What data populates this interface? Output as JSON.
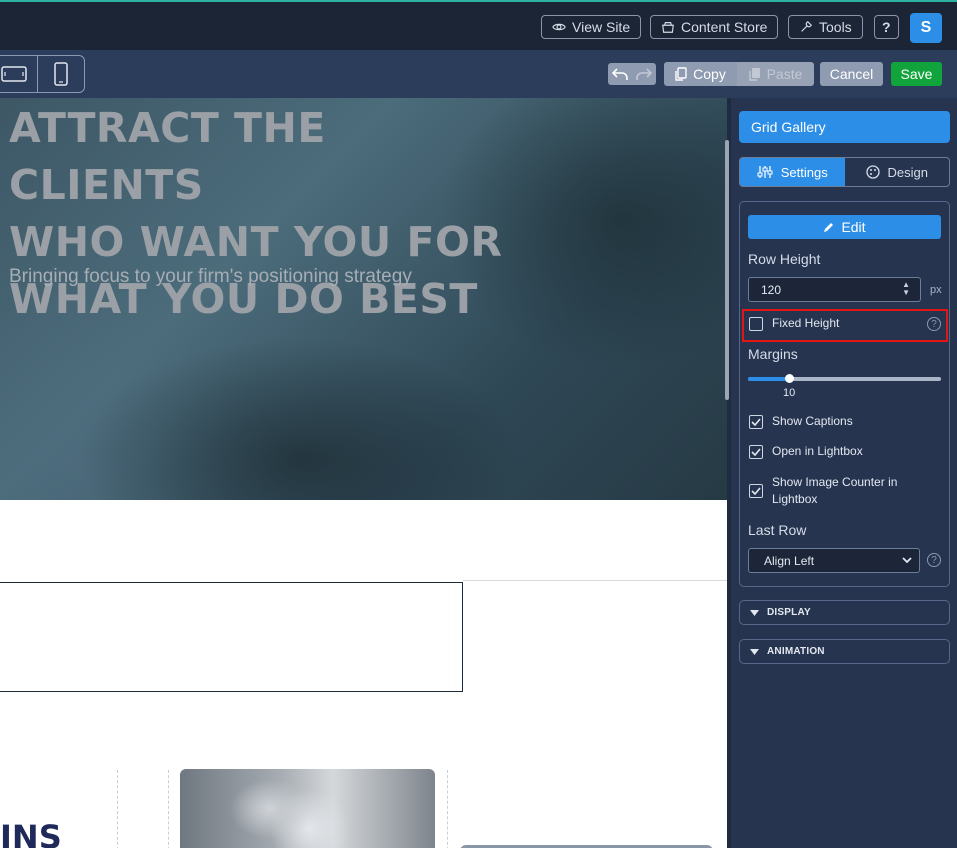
{
  "topbar": {
    "view_site": "View Site",
    "content_store": "Content Store",
    "tools": "Tools",
    "help": "?",
    "avatar_initial": "S"
  },
  "toolbar": {
    "copy": "Copy",
    "paste": "Paste",
    "cancel": "Cancel",
    "save": "Save"
  },
  "hero": {
    "title_lines": [
      "ATTRACT THE CLIENTS",
      "WHO WANT YOU FOR",
      "WHAT YOU DO BEST"
    ],
    "subtitle": "Bringing focus to your firm's positioning strategy"
  },
  "canvas": {
    "partial_heading": "INS"
  },
  "panel": {
    "header": "Grid Gallery",
    "tabs": [
      {
        "label": "Settings",
        "icon": "sliders-icon",
        "active": true
      },
      {
        "label": "Design",
        "icon": "palette-icon",
        "active": false
      }
    ],
    "edit": "Edit",
    "row_height_label": "Row Height",
    "row_height_value": "120",
    "row_height_unit": "px",
    "fixed_height": {
      "label": "Fixed Height",
      "checked": false
    },
    "margins_label": "Margins",
    "margins_value": "10",
    "margins_fraction": 0.21,
    "show_captions": {
      "label": "Show Captions",
      "checked": true
    },
    "open_lightbox": {
      "label": "Open in Lightbox",
      "checked": true
    },
    "image_counter": {
      "label_line1": "Show Image Counter in",
      "label_line2": "Lightbox",
      "checked": true
    },
    "last_row_label": "Last Row",
    "last_row_value": "Align Left",
    "sections": [
      "DISPLAY",
      "ANIMATION"
    ]
  },
  "colors": {
    "accent": "#2d8ee8",
    "save": "#12a43c",
    "highlight": "#e31515"
  }
}
